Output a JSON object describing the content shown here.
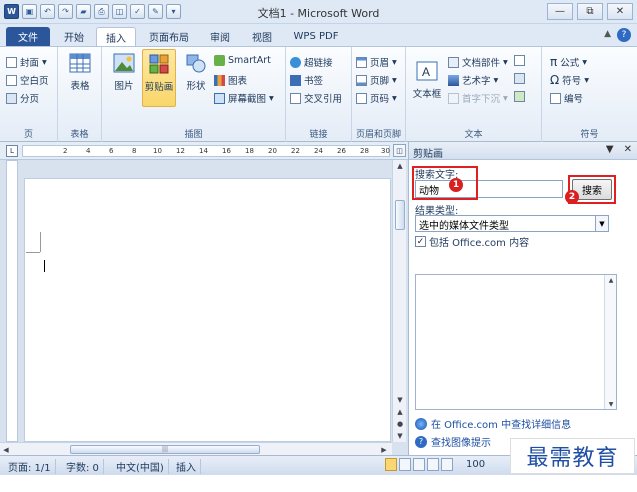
{
  "window": {
    "title": "文档1 - Microsoft Word",
    "controls": [
      "—",
      "⧉",
      "✕"
    ]
  },
  "tabs": [
    "文件",
    "开始",
    "插入",
    "页面布局",
    "审阅",
    "视图",
    "WPS PDF"
  ],
  "ribbon": {
    "pages": {
      "label": "页",
      "items": [
        "封面",
        "空白页",
        "分页"
      ]
    },
    "tables": {
      "label": "表格",
      "big": "表格"
    },
    "illustrations": {
      "label": "插图",
      "picture": "图片",
      "clipart": "剪贴画",
      "shapes": "形状",
      "smartart": "SmartArt",
      "chart": "图表",
      "screenshot": "屏幕截图"
    },
    "links": {
      "label": "链接",
      "items": [
        "超链接",
        "书签",
        "交叉引用"
      ]
    },
    "headerfooter": {
      "label": "页眉和页脚",
      "items": [
        "页眉",
        "页脚",
        "页码"
      ]
    },
    "text": {
      "label": "文本",
      "textbox": "文本框",
      "items": [
        "文档部件",
        "艺术字",
        "首字下沉"
      ]
    },
    "symbols": {
      "label": "符号",
      "items": [
        "公式",
        "符号",
        "编号"
      ]
    }
  },
  "ruler": {
    "ticks": [
      "2",
      "4",
      "6",
      "8",
      "10",
      "12",
      "14",
      "16",
      "18",
      "20",
      "22",
      "24",
      "26",
      "28",
      "30"
    ],
    "hscroll_thumb": "|||"
  },
  "pane": {
    "title": "剪贴画",
    "search_label": "搜索文字:",
    "search_value": "动物",
    "search_button": "搜索",
    "result_type_label": "结果类型:",
    "result_type_value": "选中的媒体文件类型",
    "include_label": "包括 Office.com 内容",
    "link_office": "在 Office.com 中查找详细信息",
    "link_tips": "查找图像提示",
    "badge1": "1",
    "badge2": "2"
  },
  "status": {
    "page": "页面: 1/1",
    "words": "字数: 0",
    "lang": "中文(中国)",
    "mode": "插入",
    "zoom": "100"
  },
  "watermark": "最需教育",
  "colors": {
    "accent": "#2b579a",
    "highlight": "#f9d66a",
    "annotation": "#e02020",
    "link": "#1d4fa3"
  }
}
